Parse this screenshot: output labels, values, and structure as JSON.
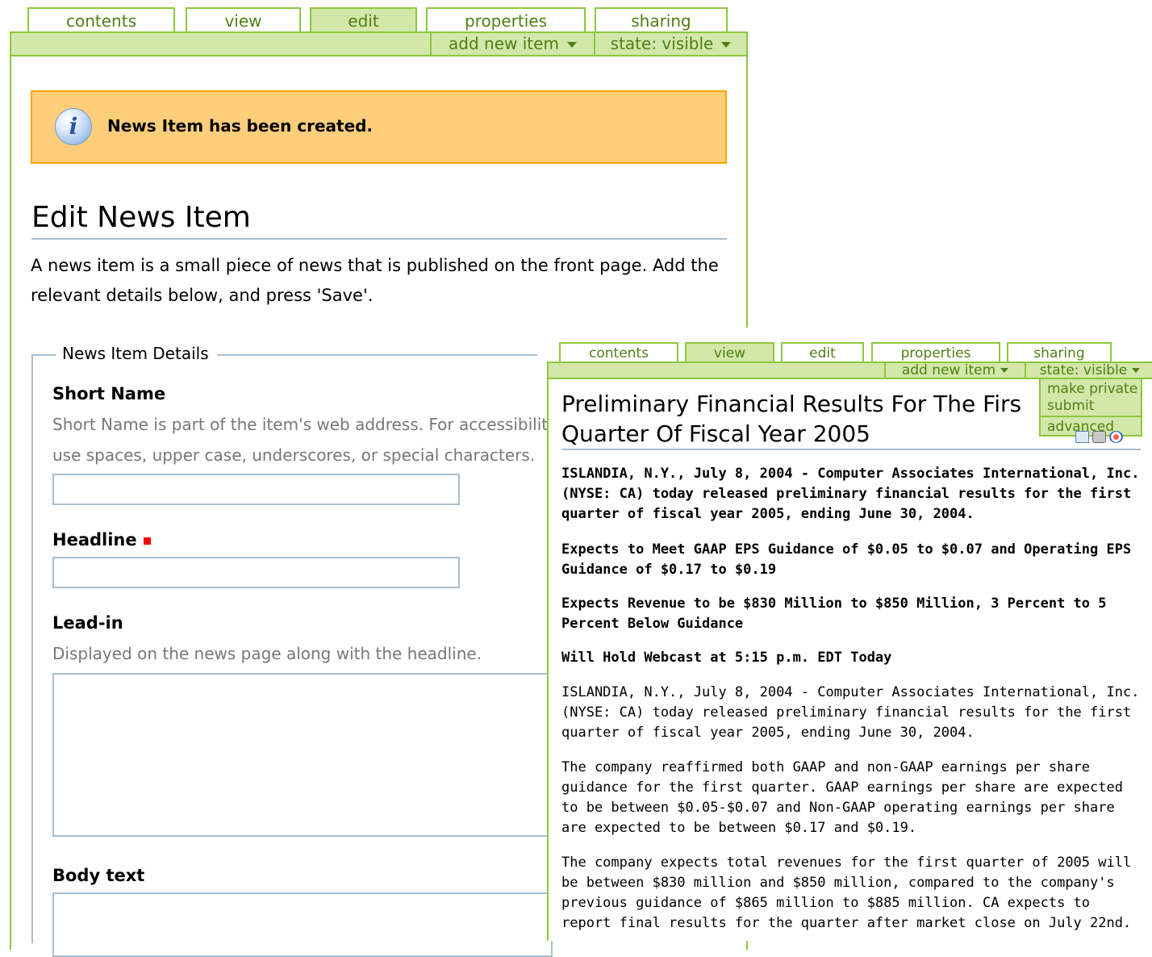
{
  "left": {
    "tabs": [
      "contents",
      "view",
      "edit",
      "properties",
      "sharing"
    ],
    "bar": {
      "add_new_item": "add new item",
      "state": "state: visible"
    },
    "message": "News Item has been created.",
    "title": "Edit News Item",
    "description": "A news item is a small piece of news that is published on the front page. Add the relevant details below, and press 'Save'.",
    "fieldset_legend": "News Item Details",
    "fields": {
      "short_name": {
        "label": "Short Name",
        "help_line1": "Short Name is part of the item's web address. For accessibilit",
        "help_line2": "use spaces, upper case, underscores, or special characters."
      },
      "headline": {
        "label": "Headline"
      },
      "lead_in": {
        "label": "Lead-in",
        "help": "Displayed on the news page along with the headline."
      },
      "body_text": {
        "label": "Body text"
      }
    }
  },
  "right": {
    "tabs": [
      "contents",
      "view",
      "edit",
      "properties",
      "sharing"
    ],
    "bar": {
      "add_new_item": "add new item",
      "state": "state: visible"
    },
    "state_menu": [
      "make private",
      "submit",
      "advanced"
    ],
    "title_line1": "Preliminary Financial Results For The Firs",
    "title_line2": "Quarter Of Fiscal Year 2005",
    "bold_paragraphs": [
      "ISLANDIA, N.Y., July 8, 2004 - Computer Associates International, Inc. (NYSE: CA) today released preliminary financial results for the first quarter of fiscal year 2005, ending June 30, 2004.",
      "Expects to Meet GAAP EPS Guidance of $0.05 to $0.07 and Operating EPS Guidance of $0.17 to $0.19",
      "Expects Revenue to be $830 Million to $850 Million, 3 Percent to 5 Percent Below Guidance",
      "Will Hold Webcast at 5:15 p.m. EDT Today"
    ],
    "paragraphs": [
      "ISLANDIA, N.Y., July 8, 2004 - Computer Associates International, Inc. (NYSE: CA) today released preliminary financial results for the first quarter of fiscal year 2005, ending June 30, 2004.",
      "The company reaffirmed both GAAP and non-GAAP earnings per share guidance for the first quarter. GAAP earnings per share are expected to be between $0.05-$0.07 and Non-GAAP operating earnings per share are expected to be between $0.17 and $0.19.",
      "The company expects total revenues for the first quarter of 2005 will be between $830 million and $850 million, compared to the company's previous guidance of $865 million to $885 million. CA expects to report final results for the quarter after market close on July 22nd."
    ]
  }
}
